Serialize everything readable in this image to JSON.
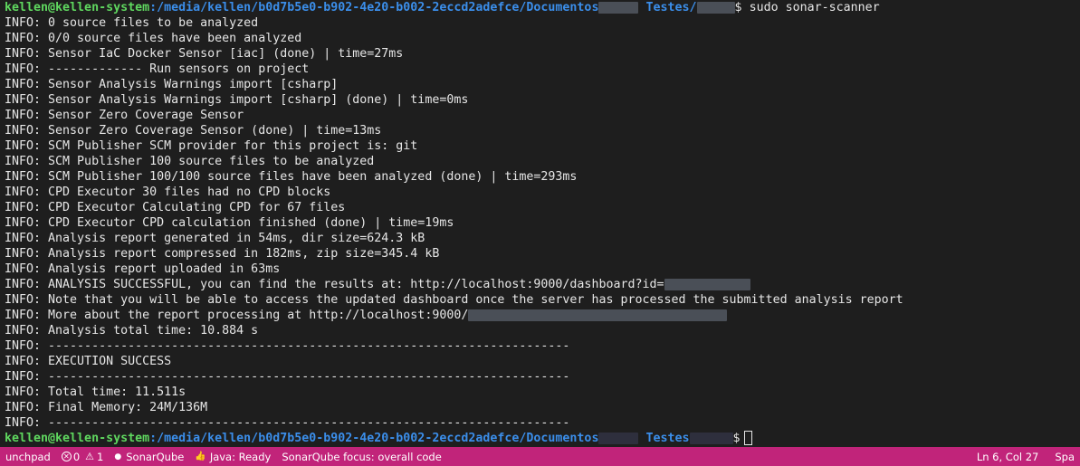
{
  "prompt": {
    "user": "kellen@kellen-system",
    "path_prefix": ":/media/kellen/b0d7b5e0-b902-4e20-b002-2eccd2adefce/Documentos",
    "path_middle": "Testes",
    "dollar": "$",
    "command": "sudo sonar-scanner"
  },
  "output_lines": [
    "INFO: 0 source files to be analyzed",
    "INFO: 0/0 source files have been analyzed",
    "INFO: Sensor IaC Docker Sensor [iac] (done) | time=27ms",
    "INFO: ------------- Run sensors on project",
    "INFO: Sensor Analysis Warnings import [csharp]",
    "INFO: Sensor Analysis Warnings import [csharp] (done) | time=0ms",
    "INFO: Sensor Zero Coverage Sensor",
    "INFO: Sensor Zero Coverage Sensor (done) | time=13ms",
    "INFO: SCM Publisher SCM provider for this project is: git",
    "INFO: SCM Publisher 100 source files to be analyzed",
    "INFO: SCM Publisher 100/100 source files have been analyzed (done) | time=293ms",
    "INFO: CPD Executor 30 files had no CPD blocks",
    "INFO: CPD Executor Calculating CPD for 67 files",
    "INFO: CPD Executor CPD calculation finished (done) | time=19ms",
    "INFO: Analysis report generated in 54ms, dir size=624.3 kB",
    "INFO: Analysis report compressed in 182ms, zip size=345.4 kB",
    "INFO: Analysis report uploaded in 63ms"
  ],
  "line_dashboard": "INFO: ANALYSIS SUCCESSFUL, you can find the results at: http://localhost:9000/dashboard?id=",
  "line_note": "INFO: Note that you will be able to access the updated dashboard once the server has processed the submitted analysis report",
  "line_more": "INFO: More about the report processing at http://localhost:9000/",
  "output_lines_tail": [
    "INFO: Analysis total time: 10.884 s",
    "INFO: ------------------------------------------------------------------------",
    "INFO: EXECUTION SUCCESS",
    "INFO: ------------------------------------------------------------------------",
    "INFO: Total time: 11.511s",
    "INFO: Final Memory: 24M/136M",
    "INFO: ------------------------------------------------------------------------"
  ],
  "statusbar": {
    "launchpad": "unchpad",
    "errors": "0",
    "warnings": "1",
    "sonarqube": "SonarQube",
    "java": "Java: Ready",
    "focus": "SonarQube focus: overall code",
    "position": "Ln 6, Col 27",
    "spaces": "Spa"
  },
  "colors": {
    "background": "#1e1e1e",
    "prompt_user": "#5fd75f",
    "prompt_path": "#3b8eea",
    "statusbar": "#c1247a"
  }
}
